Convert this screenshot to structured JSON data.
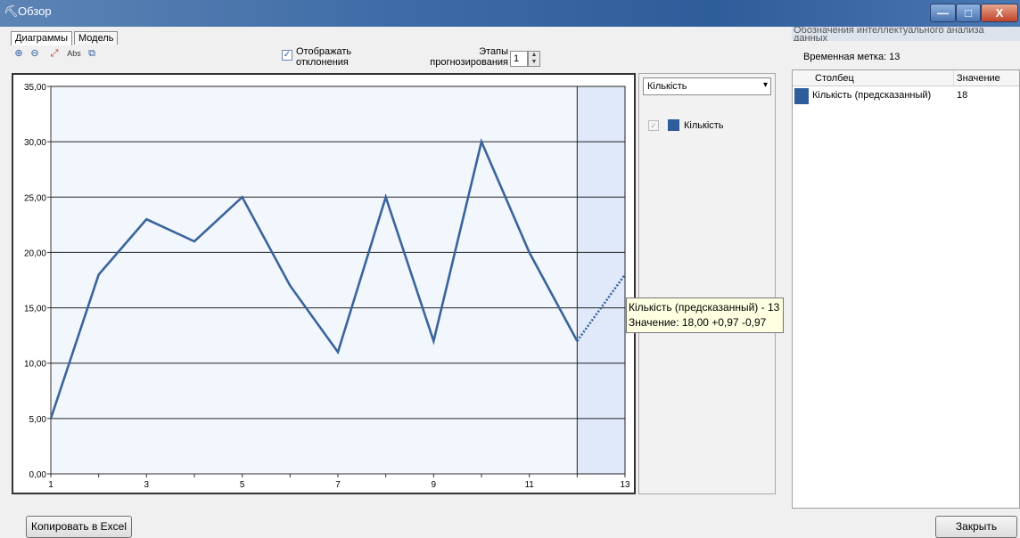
{
  "window": {
    "title": "Обзор",
    "min_symbol": "—",
    "max_symbol": "□",
    "close_symbol": "X"
  },
  "tabs": [
    {
      "label": "Диаграммы",
      "active": true
    },
    {
      "label": "Модель",
      "active": false
    }
  ],
  "toolbar": {
    "zoom_in_icon": "⊕",
    "zoom_out_icon": "⊖",
    "fit_icon": "⤢",
    "abc_text": "Abs",
    "copy_icon": "⧉"
  },
  "options": {
    "show_deviations_label": "Отображать отклонения",
    "show_deviations_checked": true,
    "check_mark": "✓",
    "prediction_steps_label": "Этапы прогнозирования",
    "prediction_steps_value": "1",
    "spin_up": "▲",
    "spin_down": "▼"
  },
  "legend": {
    "selected": "Кількість",
    "dropdown_arrow": "▾",
    "check_mark": "✓",
    "item_label": "Кількість",
    "item_color": "#2e5d9a"
  },
  "tooltip": {
    "line1": "Кількість (предсказанный) - 13",
    "line2": "Значение: 18,00 +0,97 -0,97"
  },
  "right_panel": {
    "title": "Обозначения интеллектуального анализа данных",
    "timestamp": "Временная метка: 13",
    "columns": [
      "Столбец",
      "Значение"
    ],
    "rows": [
      {
        "column": "Кількість (предсказанный)",
        "value": "18"
      }
    ]
  },
  "buttons": {
    "copy_excel": "Копировать в Excel",
    "close": "Закрыть"
  },
  "chart_data": {
    "type": "line",
    "x": [
      1,
      2,
      3,
      4,
      5,
      6,
      7,
      8,
      9,
      10,
      11,
      12,
      13
    ],
    "series": [
      {
        "name": "Кількість",
        "values": [
          5,
          18,
          23,
          21,
          25,
          17,
          11,
          25,
          12,
          30,
          20,
          12,
          18
        ],
        "color": "#3a649c"
      }
    ],
    "predicted_from_index": 11,
    "y_tick_labels": [
      "0,00",
      "5,00",
      "10,00",
      "15,00",
      "20,00",
      "25,00",
      "30,00",
      "35,00"
    ],
    "x_tick_labels": [
      "1",
      "3",
      "5",
      "7",
      "9",
      "11",
      "13"
    ],
    "ylim": [
      0,
      35
    ],
    "xlim": [
      1,
      13
    ],
    "grid": true,
    "highlight_x_from": 12,
    "title": "",
    "xlabel": "",
    "ylabel": ""
  }
}
